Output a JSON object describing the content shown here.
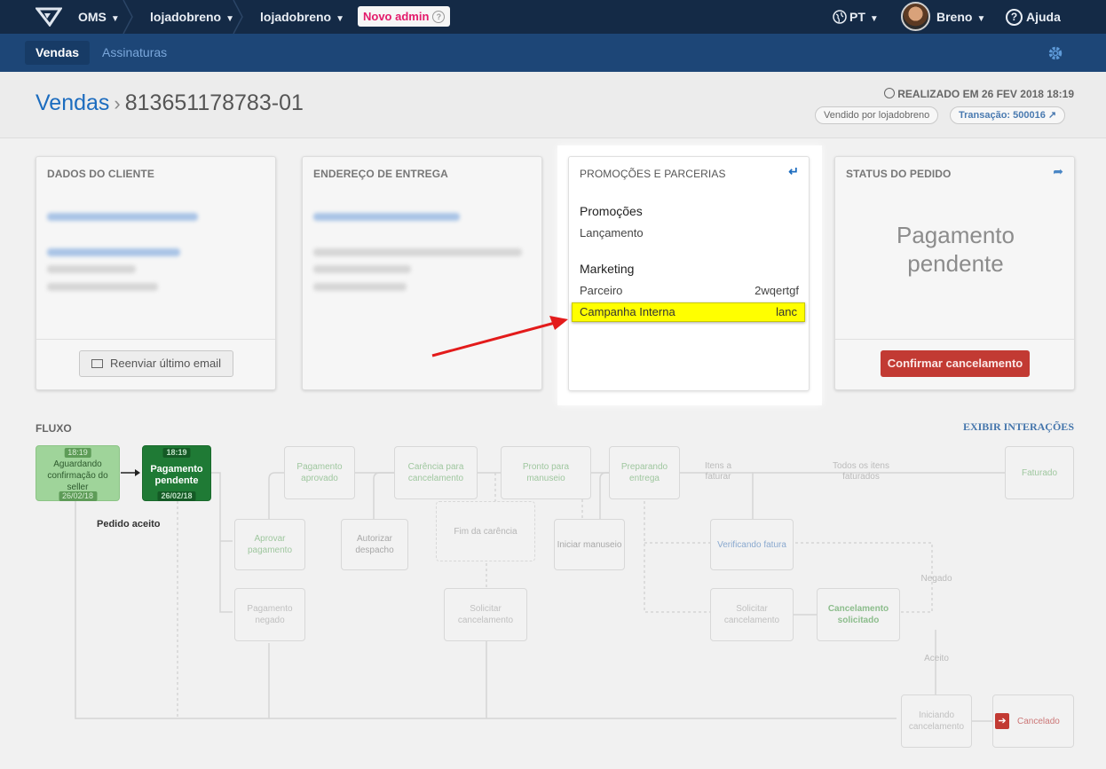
{
  "topbar": {
    "oms": "OMS",
    "account1": "lojadobreno",
    "account2": "lojadobreno",
    "new_admin": "Novo admin",
    "lang": "PT",
    "user": "Breno",
    "help": "Ajuda"
  },
  "subnav": {
    "tabs": [
      "Vendas",
      "Assinaturas"
    ]
  },
  "header": {
    "section": "Vendas",
    "order_id": "813651178783-01",
    "realizado": "REALIZADO EM 26 FEV 2018 18:19",
    "sold_by": "Vendido por lojadobreno",
    "transaction": "Transação: 500016"
  },
  "cards": {
    "client": {
      "title": "DADOS DO CLIENTE",
      "button": "Reenviar último email"
    },
    "address": {
      "title": "ENDEREÇO DE ENTREGA"
    },
    "promo": {
      "title": "PROMOÇÕES E PARCERIAS",
      "promocoes_heading": "Promoções",
      "promocoes_value": "Lançamento",
      "marketing_heading": "Marketing",
      "parceiro_label": "Parceiro",
      "parceiro_value": "2wqertgf",
      "campanha_label": "Campanha Interna",
      "campanha_value": "lanc"
    },
    "status": {
      "title": "STATUS DO PEDIDO",
      "status_line1": "Pagamento",
      "status_line2": "pendente",
      "button": "Confirmar cancelamento"
    }
  },
  "flow": {
    "title": "FLUXO",
    "link": "EXIBIR INTERAÇÕES",
    "pedido_aceito": "Pedido aceito",
    "nodes": {
      "aguardando": {
        "time": "18:19",
        "label": "Aguardando confirmação do seller",
        "date": "26/02/18"
      },
      "pag_pendente": {
        "time": "18:19",
        "label": "Pagamento pendente",
        "date": "26/02/18"
      },
      "pag_aprovado": "Pagamento aprovado",
      "carencia": "Carência para cancelamento",
      "pronto": "Pronto para manuseio",
      "preparando": "Preparando entrega",
      "faturado": "Faturado",
      "aprovar": "Aprovar pagamento",
      "autorizar": "Autorizar despacho",
      "fim_carencia": "Fim da carência",
      "iniciar": "Iniciar manuseio",
      "verificando": "Verificando fatura",
      "pag_negado": "Pagamento negado",
      "solicitar1": "Solicitar cancelamento",
      "solicitar2": "Solicitar cancelamento",
      "canc_solicitado": "Cancelamento solicitado",
      "iniciando": "Iniciando cancelamento",
      "cancelado": "Cancelado"
    },
    "edges": {
      "itens_faturar": "Itens a faturar",
      "todos_faturados": "Todos os itens faturados",
      "negado": "Negado",
      "aceito": "Aceito"
    }
  }
}
